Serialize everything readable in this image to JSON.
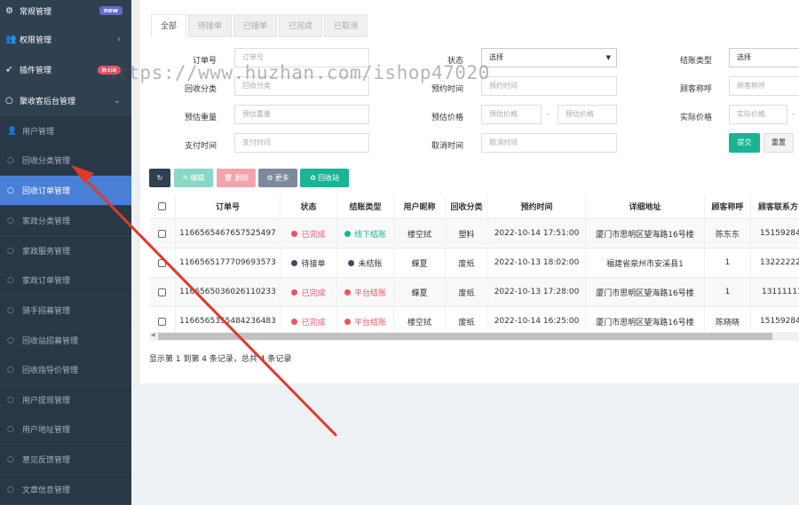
{
  "sidebar": {
    "items": [
      {
        "label": "常规管理",
        "icon": "gears-icon",
        "badge": "new",
        "badge_color": "purple",
        "level": "top"
      },
      {
        "label": "权限管理",
        "icon": "users-icon",
        "chevron": "‹",
        "level": "top"
      },
      {
        "label": "插件管理",
        "icon": "rocket-icon",
        "badge": "new",
        "badge_color": "red",
        "level": "top"
      },
      {
        "label": "聚收客后台管理",
        "icon": "circle-icon",
        "chevron": "⌄",
        "level": "top"
      },
      {
        "label": "用户管理",
        "icon": "user-icon",
        "level": "sub"
      },
      {
        "label": "回收分类管理",
        "icon": "circle-icon",
        "level": "sub"
      },
      {
        "label": "回收订单管理",
        "icon": "circle-icon",
        "level": "sub",
        "active": true
      },
      {
        "label": "家政分类管理",
        "icon": "circle-icon",
        "level": "sub"
      },
      {
        "label": "家政服务管理",
        "icon": "circle-icon",
        "level": "sub"
      },
      {
        "label": "家政订单管理",
        "icon": "circle-icon",
        "level": "sub"
      },
      {
        "label": "骑手招募管理",
        "icon": "circle-icon",
        "level": "sub"
      },
      {
        "label": "回收站招募管理",
        "icon": "circle-icon",
        "level": "sub"
      },
      {
        "label": "回收指导价管理",
        "icon": "circle-icon",
        "level": "sub"
      },
      {
        "label": "用户提现管理",
        "icon": "circle-icon",
        "level": "sub"
      },
      {
        "label": "用户地址管理",
        "icon": "circle-icon",
        "level": "sub"
      },
      {
        "label": "意见反馈管理",
        "icon": "circle-icon",
        "level": "sub"
      },
      {
        "label": "文章信息管理",
        "icon": "circle-icon",
        "level": "sub"
      }
    ]
  },
  "tabs": [
    "全部",
    "待接单",
    "已接单",
    "已完成",
    "已取消"
  ],
  "filters": {
    "order_no": {
      "label": "订单号",
      "placeholder": "订单号"
    },
    "status": {
      "label": "状态",
      "value": "选择"
    },
    "settle_type": {
      "label": "结账类型",
      "value": "选择"
    },
    "category": {
      "label": "回收分类",
      "placeholder": "回收分类"
    },
    "book_time": {
      "label": "预约时间",
      "placeholder": "预约时间"
    },
    "nickname": {
      "label": "顾客称呼",
      "placeholder": "顾客称呼"
    },
    "est_weight": {
      "label": "预估重量",
      "placeholder": "预估重量"
    },
    "est_price": {
      "label": "预估价格",
      "placeholder_from": "预估价格",
      "placeholder_to": "预估价格",
      "sep": "-"
    },
    "real_price": {
      "label": "实际价格",
      "placeholder_from": "实际价格",
      "sep": "-"
    },
    "pay_time": {
      "label": "支付时间",
      "placeholder": "支付时间"
    },
    "cancel_time": {
      "label": "取消时间",
      "placeholder": "取消时间"
    },
    "submit": "提交",
    "reset": "重置"
  },
  "toolbar": {
    "refresh_icon": "refresh-icon",
    "edit": "编辑",
    "delete": "删除",
    "more": "更多",
    "recycle": "回收站"
  },
  "table": {
    "headers": [
      "订单号",
      "状态",
      "结账类型",
      "用户昵称",
      "回收分类",
      "预约时间",
      "详细地址",
      "顾客称呼",
      "顾客联系方"
    ],
    "rows": [
      {
        "order_no": "1166565467657525497",
        "status": "已完成",
        "status_color": "#ed5565",
        "settle": "线下结账",
        "settle_color": "#1ab394",
        "nick": "楼空拭",
        "cat": "塑料",
        "time": "2022-10-14 17:51:00",
        "addr": "厦门市思明区望海路16号楼",
        "customer": "陈东东",
        "phone": "15159284"
      },
      {
        "order_no": "1166565177709693573",
        "status": "待接单",
        "status_color": "#3d4a66",
        "settle": "未结账",
        "settle_color": "#3d4a66",
        "nick": "蝶夏",
        "cat": "废纸",
        "time": "2022-10-13 18:02:00",
        "addr": "福建省泉州市安溪县1",
        "customer": "1",
        "phone": "13222222"
      },
      {
        "order_no": "1166565036026110233",
        "status": "已完成",
        "status_color": "#ed5565",
        "settle": "平台结账",
        "settle_color": "#ed5565",
        "nick": "蝶夏",
        "cat": "废纸",
        "time": "2022-10-13 17:28:00",
        "addr": "厦门市思明区望海路16号楼",
        "customer": "1",
        "phone": "13111111"
      },
      {
        "order_no": "1166565355484236483",
        "status": "已完成",
        "status_color": "#ed5565",
        "settle": "平台结账",
        "settle_color": "#ed5565",
        "nick": "楼空拭",
        "cat": "废纸",
        "time": "2022-10-14 16:25:00",
        "addr": "厦门市思明区望海路16号楼",
        "customer": "陈晓晓",
        "phone": "15159284"
      }
    ]
  },
  "pagination": {
    "summary": "显示第 1 到第 4 条记录，总共 4 条记录"
  },
  "watermark": "https://www.huzhan.com/ishop47020",
  "colors": {
    "sidebar_bg": "#2f4050",
    "active": "#4a7fd6",
    "primary": "#1ab394",
    "danger": "#ed5565",
    "annotation_arrow": "#e0392b"
  }
}
